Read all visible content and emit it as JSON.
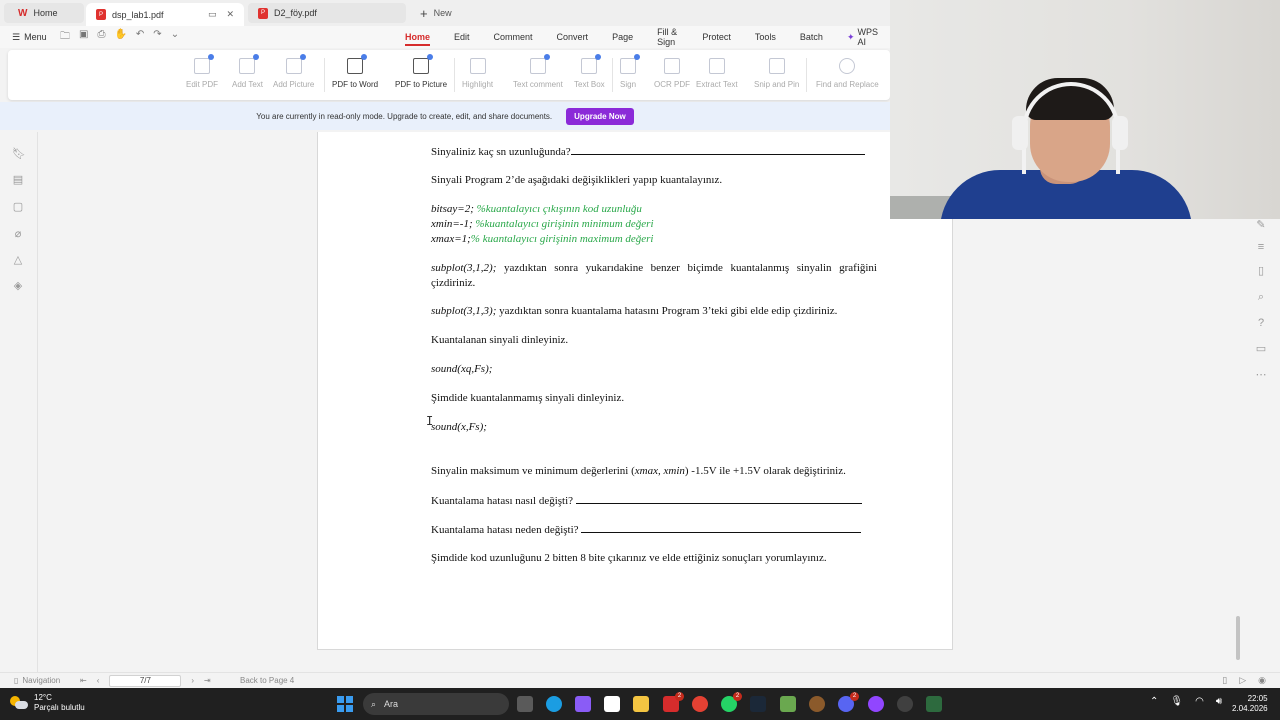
{
  "tabs": {
    "home": "Home",
    "active_file": "dsp_lab1.pdf",
    "inactive_file": "D2_föy.pdf",
    "new": "New"
  },
  "menu": {
    "menu_label": "Menu",
    "ribbon_tabs": [
      "Home",
      "Edit",
      "Comment",
      "Convert",
      "Page",
      "Fill & Sign",
      "Protect",
      "Tools",
      "Batch",
      "WPS AI"
    ]
  },
  "toolbar": {
    "edit_pdf": "Edit PDF",
    "add_text": "Add Text",
    "add_picture": "Add Picture",
    "pdf_to_word": "PDF to Word",
    "pdf_to_picture": "PDF to Picture",
    "highlight": "Highlight",
    "text_comment": "Text comment",
    "text_box": "Text Box",
    "sign": "Sign",
    "ocr_pdf": "OCR PDF",
    "extract_text": "Extract Text",
    "snip_and_pin": "Snip and Pin",
    "find_and_replace": "Find and Replace"
  },
  "banner": {
    "message": "You are currently in read-only mode. Upgrade to create, edit, and share documents.",
    "button": "Upgrade Now"
  },
  "document": {
    "q_length": "Sinyaliniz kaç sn uzunluğunda?",
    "instruction_program2": "Sinyali Program 2’de aşağıdaki değişiklikleri yapıp kuantalayınız.",
    "code_bitsay": "bitsay=2;",
    "comment_bitsay": "%kuantalayıcı çıkışının kod uzunluğu",
    "code_xmin": "xmin=-1;",
    "comment_xmin": "%kuantalayıcı girişinin minimum değeri",
    "code_xmax": "xmax=1;",
    "comment_xmax": "% kuantalayıcı girişinin maximum değeri",
    "subplot312_code": "subplot(3,1,2);",
    "subplot312_text": " yazdıktan sonra yukarıdakine benzer biçimde kuantalanmış sinyalin grafiğini çizdiriniz.",
    "subplot313_code": "subplot(3,1,3);",
    "subplot313_text": " yazdıktan sonra kuantalama hatasını Program 3’teki gibi elde edip çizdiriniz.",
    "listen_quantized": "Kuantalanan sinyali dinleyiniz.",
    "sound_xq": "sound(xq,Fs);",
    "listen_original": "Şimdide kuantalanmamış sinyali dinleyiniz.",
    "sound_x": "sound(x,Fs);",
    "change_max_min_a": "Sinyalin maksimum ve minimum değerlerini (",
    "change_max_min_vars": "xmax, xmin",
    "change_max_min_b": ") -1.5V ile +1.5V olarak değiştiriniz.",
    "q_how_changed": "Kuantalama hatası nasıl değişti?",
    "q_why_changed": "Kuantalama hatası neden değişti?",
    "final_instruction": "Şimdide kod uzunluğunu 2 bitten 8 bite çıkarınız ve elde ettiğiniz sonuçları yorumlayınız."
  },
  "status": {
    "navigation": "Navigation",
    "page_indicator": "7/7",
    "back_to_page": "Back to Page 4"
  },
  "taskbar": {
    "temperature": "12°C",
    "weather": "Parçalı bulutlu",
    "search_placeholder": "Ara",
    "time": "22:05",
    "date": "2.04.2026",
    "badge_whatsapp": "2",
    "badge_discord": "2",
    "badge_wps": "2"
  }
}
